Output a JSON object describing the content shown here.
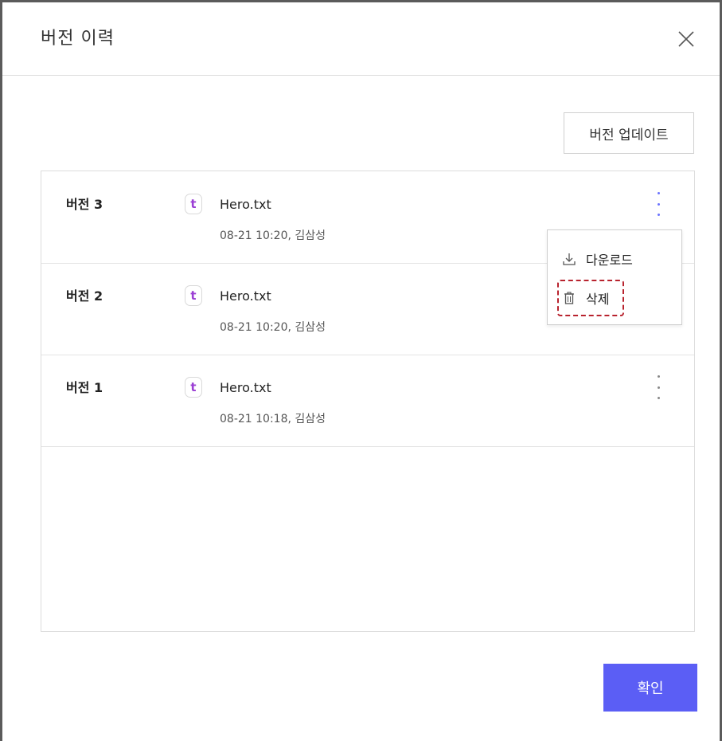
{
  "dialog": {
    "title": "버전 이력",
    "close_icon": "close-icon"
  },
  "toolbar": {
    "update_label": "버전 업데이트"
  },
  "versions": [
    {
      "label": "버전 3",
      "file_icon_letter": "t",
      "file_name": "Hero.txt",
      "meta": "08-21 10:20, 김삼성"
    },
    {
      "label": "버전 2",
      "file_icon_letter": "t",
      "file_name": "Hero.txt",
      "meta": "08-21 10:20, 김삼성"
    },
    {
      "label": "버전 1",
      "file_icon_letter": "t",
      "file_name": "Hero.txt",
      "meta": "08-21 10:18, 김삼성"
    }
  ],
  "context_menu": {
    "items": [
      {
        "label": "다운로드",
        "icon": "download-icon"
      },
      {
        "label": "삭제",
        "icon": "trash-icon"
      }
    ]
  },
  "footer": {
    "confirm_label": "확인"
  },
  "colors": {
    "accent": "#5b5ef5",
    "file_icon": "#9b3fd4",
    "highlight": "#b8232e",
    "kebab_active": "#6b73ff"
  }
}
